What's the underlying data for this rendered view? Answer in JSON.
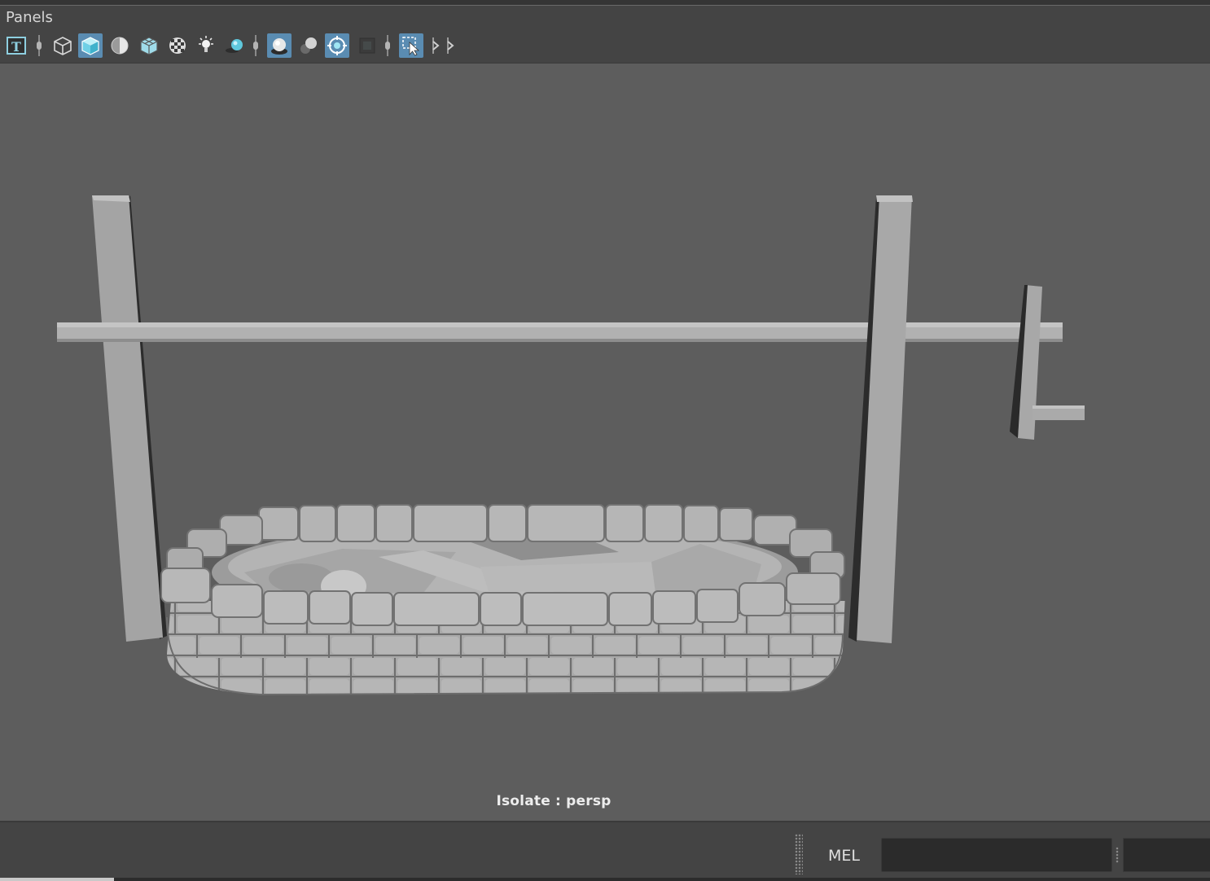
{
  "menubar": {
    "panels_label": "Panels"
  },
  "toolbar": {
    "items": [
      {
        "icon": "text-icon",
        "state": "off"
      },
      {
        "icon": "wireframe-cube-icon",
        "state": "off"
      },
      {
        "icon": "smooth-shade-cube-icon",
        "state": "on"
      },
      {
        "icon": "shaded-sphere-icon",
        "state": "off"
      },
      {
        "icon": "wireframe-on-shaded-icon",
        "state": "off"
      },
      {
        "icon": "checker-texture-icon",
        "state": "off"
      },
      {
        "icon": "light-bulb-icon",
        "state": "off"
      },
      {
        "icon": "shadows-icon",
        "state": "off"
      },
      {
        "icon": "ambient-occlusion-icon",
        "state": "on"
      },
      {
        "icon": "motion-blur-icon",
        "state": "off"
      },
      {
        "icon": "isolate-select-icon",
        "state": "on"
      },
      {
        "icon": "xray-icon",
        "state": "off"
      },
      {
        "icon": "select-tool-icon",
        "state": "on"
      }
    ]
  },
  "viewport": {
    "caption": "Isolate : persp"
  },
  "statusbar": {
    "mel_label": "MEL",
    "command_value": ""
  },
  "colors": {
    "toggle_on": "#5a8cb2",
    "viewport_bg": "#5d5d5d",
    "panel_bg": "#444444"
  }
}
